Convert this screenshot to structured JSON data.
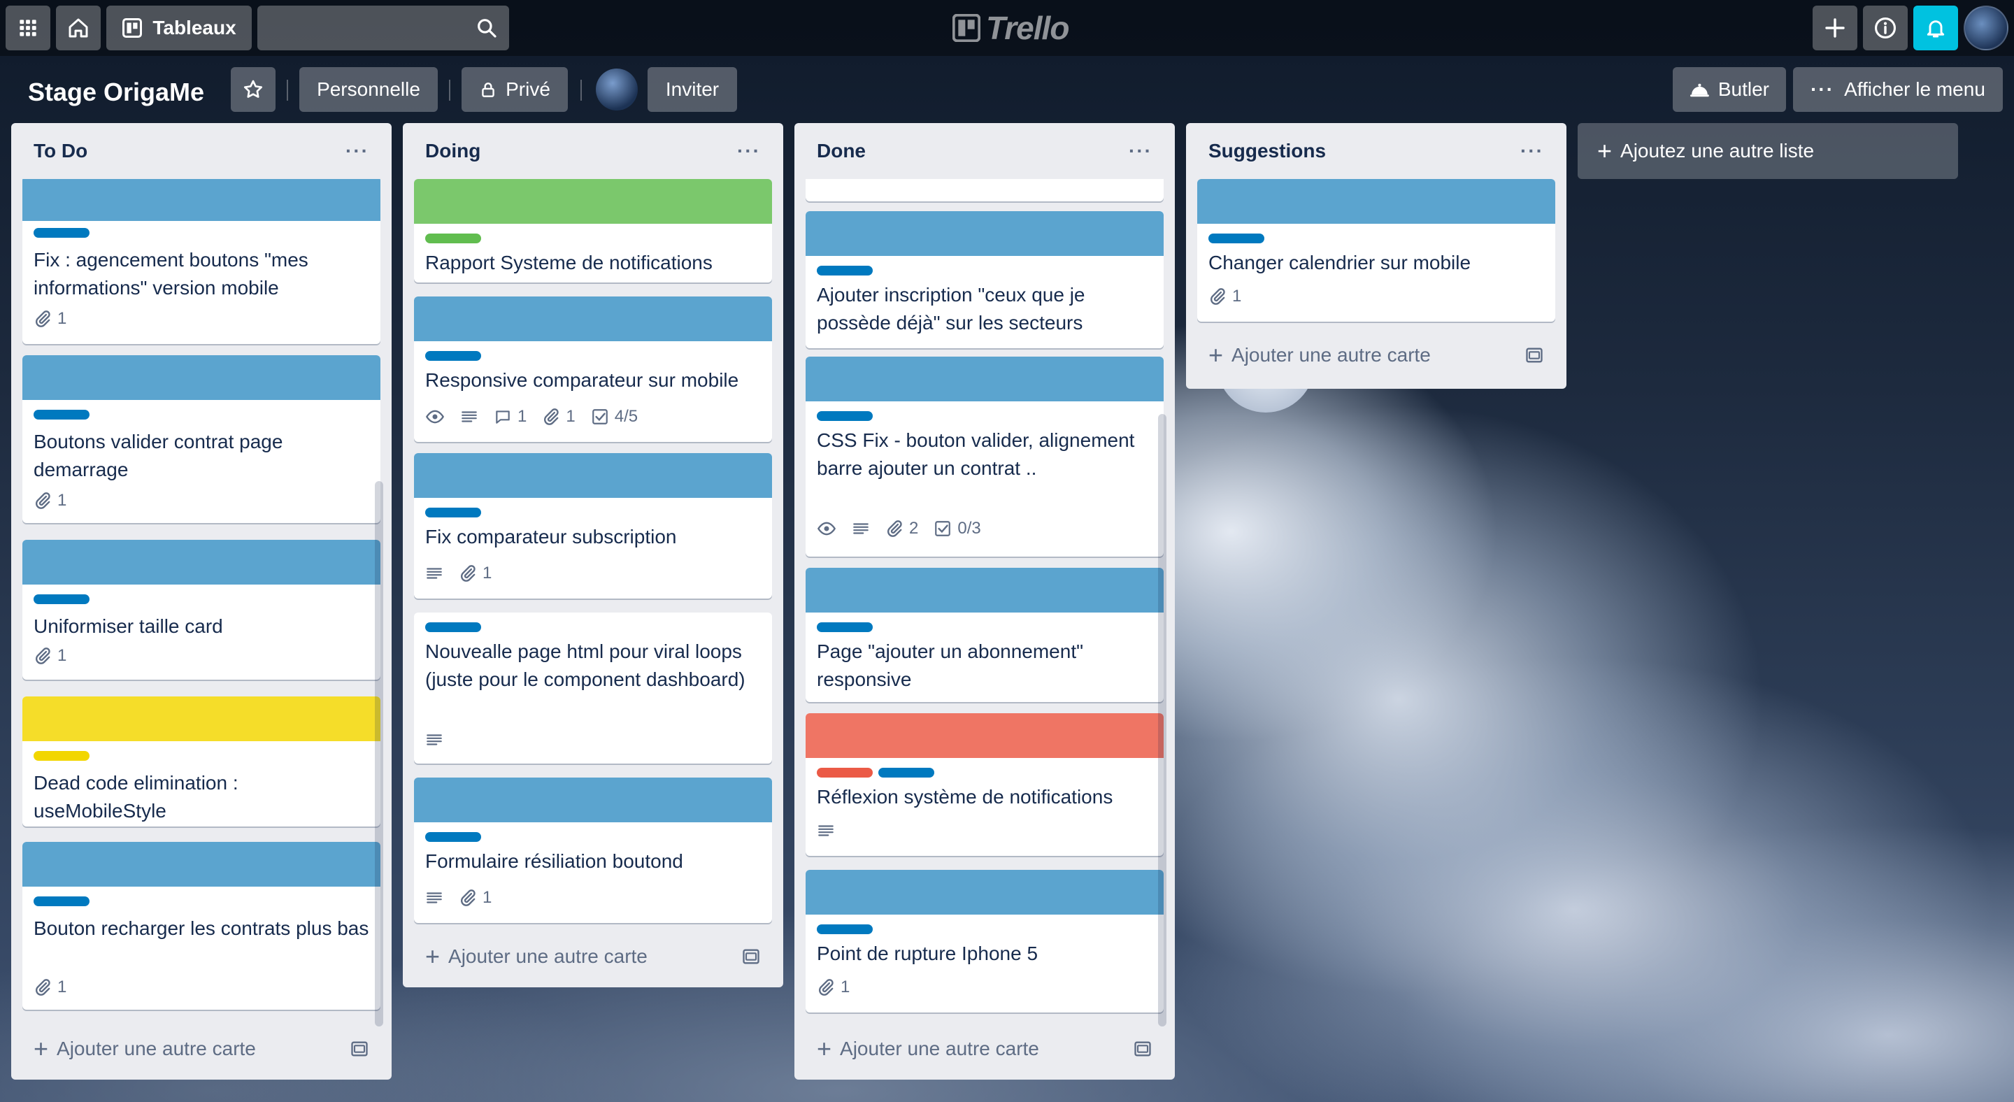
{
  "topbar": {
    "boards_label": "Tableaux",
    "search_placeholder": "",
    "logo_text": "Trello"
  },
  "board": {
    "title": "Stage OrigaMe",
    "team_label": "Personnelle",
    "visibility_label": "Privé",
    "invite_label": "Inviter",
    "butler_label": "Butler",
    "menu_label": "Afficher le menu"
  },
  "colors": {
    "blue": "#5ba4cf",
    "label_blue": "#0079bf",
    "green": "#7bc86c",
    "label_green": "#61bd4f",
    "yellow": "#f5dd29",
    "label_yellow": "#f2d600",
    "red": "#ef7564",
    "label_red": "#eb5a46",
    "notification": "#00c2e0"
  },
  "lists": [
    {
      "title": "To Do",
      "add_card_label": "Ajouter une autre carte",
      "cards": [
        {
          "title": "Fix : agencement boutons \"mes informations\" version mobile",
          "cover": "blue",
          "labels": [
            "blue"
          ],
          "attachments": "1"
        },
        {
          "title": "Boutons valider contrat page demarrage",
          "cover": "blue",
          "labels": [
            "blue"
          ],
          "attachments": "1"
        },
        {
          "title": "Uniformiser taille card",
          "cover": "blue",
          "labels": [
            "blue"
          ],
          "attachments": "1"
        },
        {
          "title": "Dead code elimination : useMobileStyle",
          "cover": "yellow",
          "labels": [
            "yellow"
          ]
        },
        {
          "title": "Bouton recharger les contrats plus bas",
          "cover": "blue",
          "labels": [
            "blue"
          ],
          "attachments": "1"
        }
      ]
    },
    {
      "title": "Doing",
      "add_card_label": "Ajouter une autre carte",
      "cards": [
        {
          "title": "Rapport Systeme de notifications",
          "cover": "green",
          "labels": [
            "green"
          ]
        },
        {
          "title": "Responsive comparateur sur mobile",
          "cover": "blue",
          "labels": [
            "blue"
          ],
          "watch": true,
          "description": true,
          "comments": "1",
          "attachments": "1",
          "checklist": "4/5"
        },
        {
          "title": "Fix comparateur subscription",
          "cover": "blue",
          "labels": [
            "blue"
          ],
          "description": true,
          "attachments": "1"
        },
        {
          "title": "Nouvealle page html pour viral loops (juste pour le component dashboard)",
          "labels": [
            "blue"
          ],
          "description": true
        },
        {
          "title": "Formulaire résiliation boutond",
          "cover": "blue",
          "labels": [
            "blue"
          ],
          "description": true,
          "attachments": "1"
        }
      ]
    },
    {
      "title": "Done",
      "add_card_label": "Ajouter une autre carte",
      "cards": [
        {
          "title": "Ajouter inscription \"ceux que je possède déjà\" sur les secteurs",
          "cover": "blue",
          "labels": [
            "blue"
          ]
        },
        {
          "title": "CSS Fix - bouton valider, alignement barre ajouter un contrat ..",
          "cover": "blue",
          "labels": [
            "blue"
          ],
          "watch": true,
          "description": true,
          "attachments": "2",
          "checklist": "0/3"
        },
        {
          "title": "Page \"ajouter un abonnement\" responsive",
          "cover": "blue",
          "labels": [
            "blue"
          ]
        },
        {
          "title": "Réflexion système de notifications",
          "cover": "red",
          "labels": [
            "red",
            "blue"
          ],
          "description": true
        },
        {
          "title": "Point de rupture Iphone 5",
          "cover": "blue",
          "labels": [
            "blue"
          ],
          "attachments": "1"
        }
      ]
    },
    {
      "title": "Suggestions",
      "add_card_label": "Ajouter une autre carte",
      "cards": [
        {
          "title": "Changer calendrier sur mobile",
          "cover": "blue",
          "labels": [
            "blue"
          ],
          "attachments": "1"
        }
      ]
    }
  ],
  "add_list_label": "Ajoutez une autre liste"
}
